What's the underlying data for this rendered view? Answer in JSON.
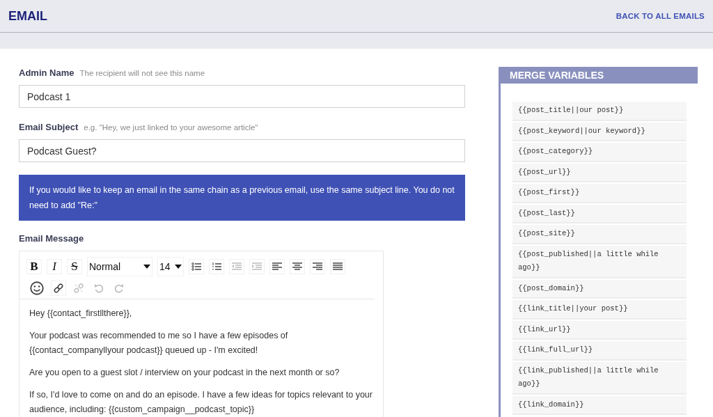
{
  "header": {
    "title": "EMAIL",
    "back_link": "BACK TO ALL EMAILS"
  },
  "fields": [
    {
      "label": "Admin Name",
      "hint": "The recipient will not see this name",
      "value": "Podcast 1"
    },
    {
      "label": "Email Subject",
      "hint": "e.g. \"Hey, we just linked to your awesome article\"",
      "value": "Podcast Guest?"
    }
  ],
  "notice": "If you would like to keep an email in the same chain as a previous email, use the same subject line. You do not need to add \"Re:\"",
  "message": {
    "label": "Email Message",
    "toolbar": [
      {
        "kind": "bold",
        "label": "B",
        "disabled": false
      },
      {
        "kind": "italic",
        "label": "I",
        "disabled": false
      },
      {
        "kind": "strike",
        "label": "S",
        "disabled": false
      },
      {
        "kind": "heading-select",
        "label": "Normal",
        "disabled": false
      },
      {
        "kind": "size-select",
        "label": "14",
        "disabled": false
      },
      {
        "kind": "bullet-list",
        "disabled": false
      },
      {
        "kind": "numbered-list",
        "disabled": false
      },
      {
        "kind": "outdent",
        "disabled": true
      },
      {
        "kind": "indent",
        "disabled": true
      },
      {
        "kind": "align-left",
        "disabled": false
      },
      {
        "kind": "align-center",
        "disabled": false
      },
      {
        "kind": "align-right",
        "disabled": false
      },
      {
        "kind": "justify",
        "disabled": false
      },
      {
        "kind": "emoji",
        "disabled": false
      },
      {
        "kind": "link",
        "disabled": false
      },
      {
        "kind": "unlink",
        "disabled": true
      },
      {
        "kind": "undo",
        "disabled": true
      },
      {
        "kind": "redo",
        "disabled": true
      }
    ],
    "paragraphs": [
      "Hey {{contact_firstllthere}},",
      "Your podcast was recommended to me so I have a few episodes of {{contact_companyllyour podcast}} queued up - I'm excited!",
      "Are you open to a guest slot / interview on your podcast in the next month or so?",
      "If so, I'd love to come on and do an episode. I have a few ideas for topics relevant to your audience, including: {{custom_campaign__podcast_topic}}"
    ]
  },
  "merge_variables": {
    "title": "MERGE VARIABLES",
    "items": [
      "{{post_title||our post}}",
      "{{post_keyword||our keyword}}",
      "{{post_category}}",
      "{{post_url}}",
      "{{post_first}}",
      "{{post_last}}",
      "{{post_site}}",
      "{{post_published||a little while ago}}",
      "{{post_domain}}",
      "{{link_title||your post}}",
      "{{link_url}}",
      "{{link_full_url}}",
      "{{link_published||a little while ago}}",
      "{{link_domain}}"
    ]
  }
}
